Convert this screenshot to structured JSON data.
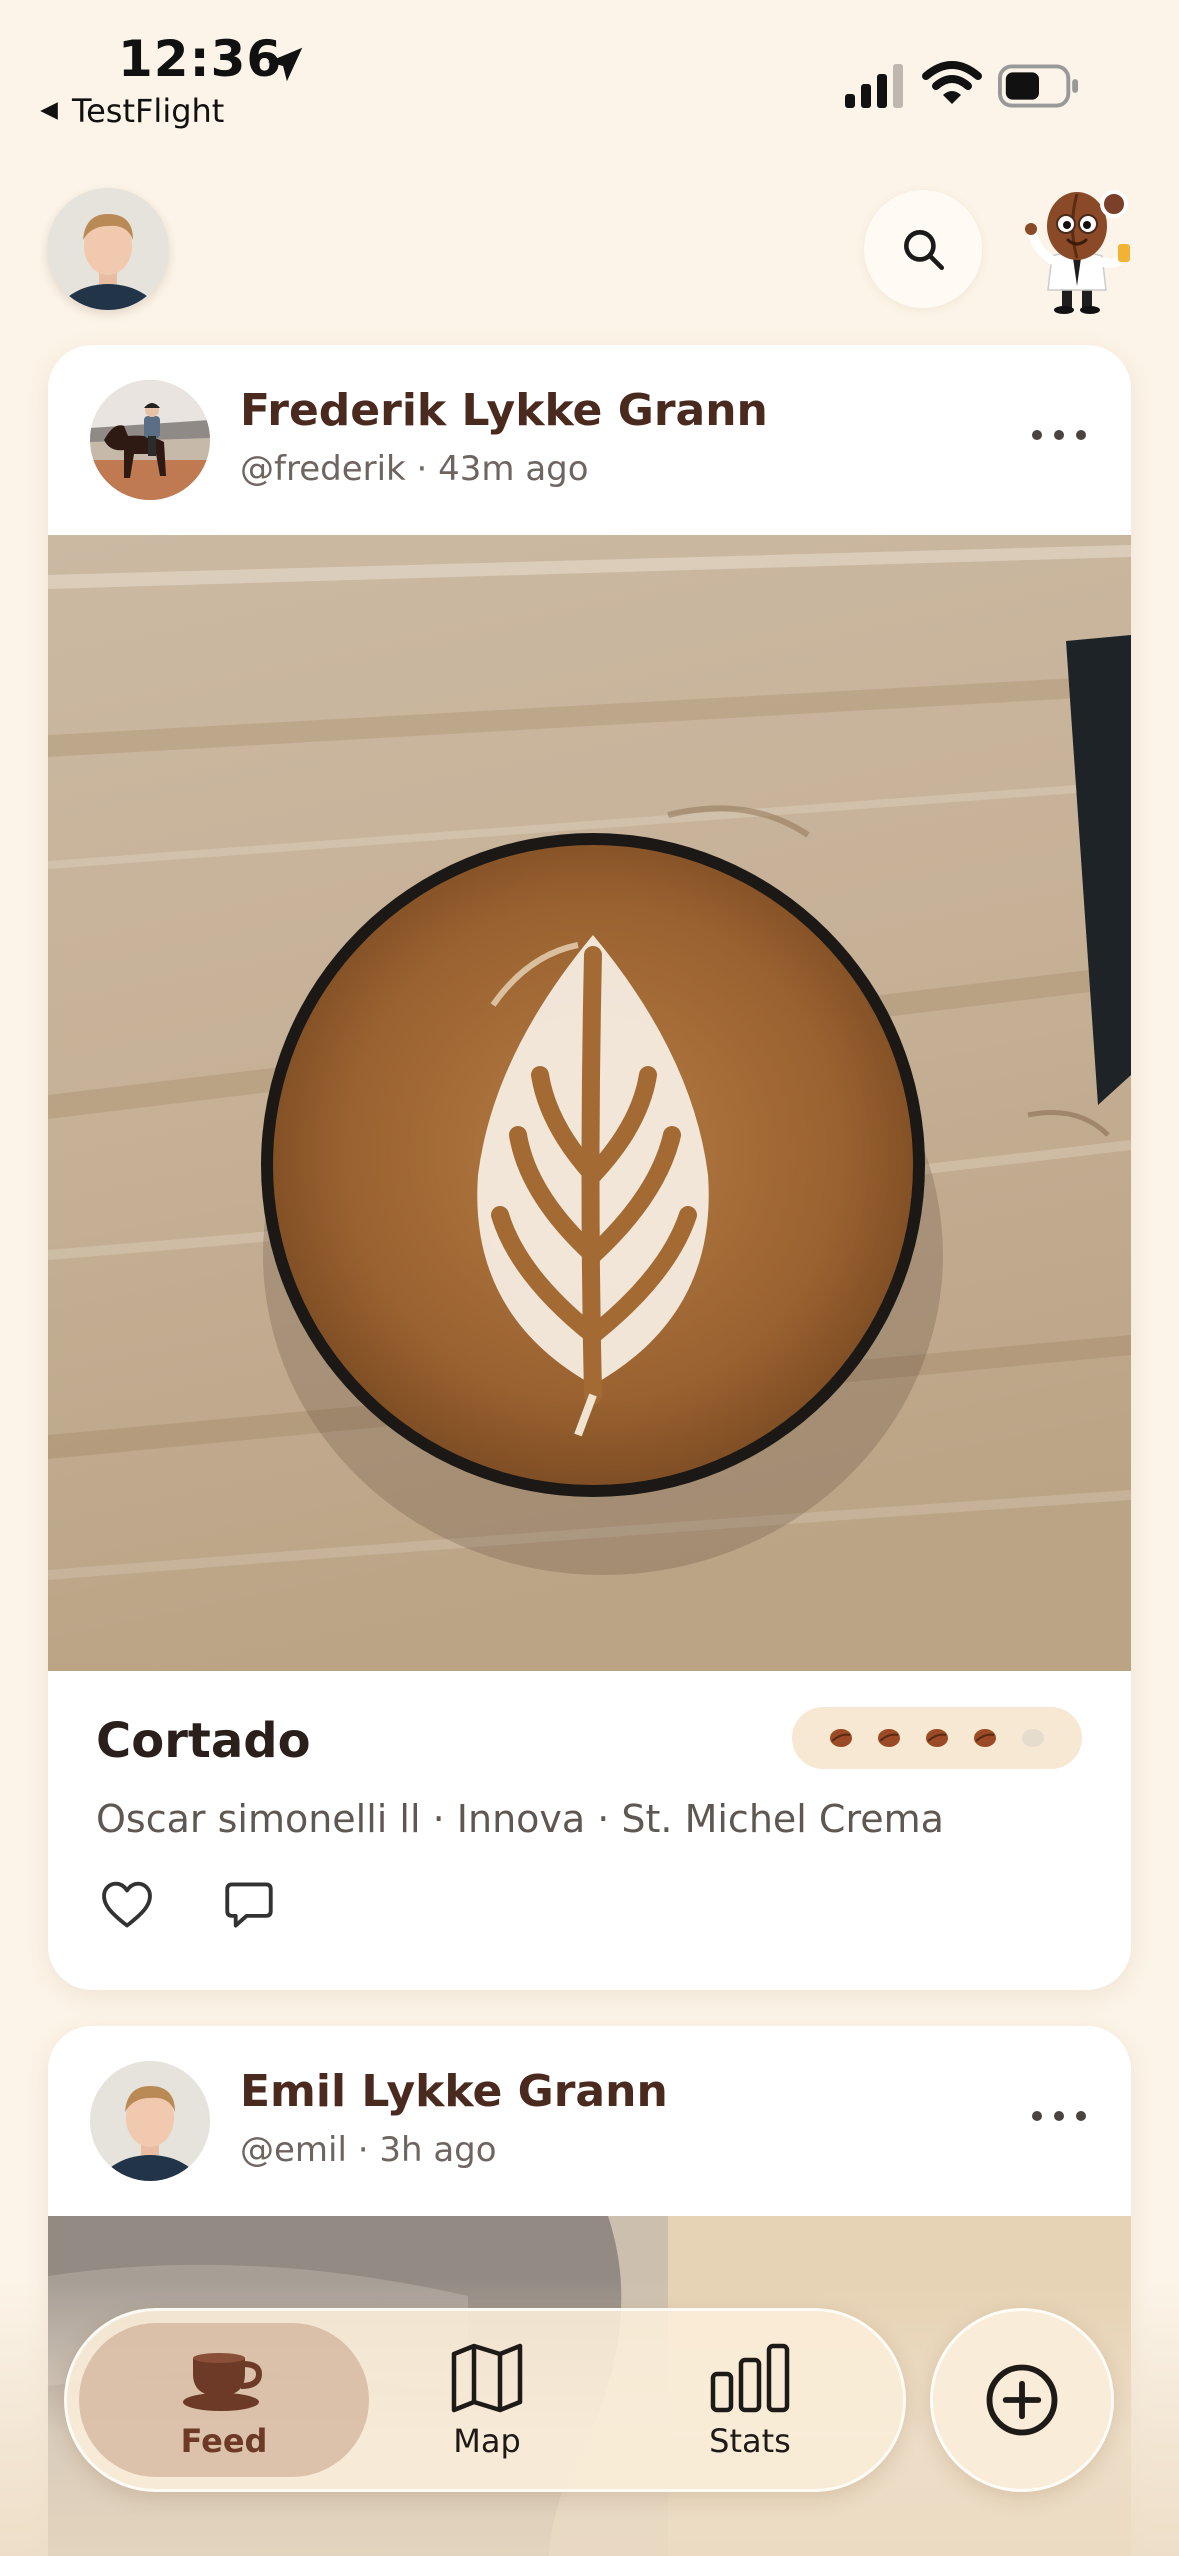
{
  "status_bar": {
    "time": "12:36",
    "back_app": "TestFlight"
  },
  "header": {
    "search_icon": "search-icon",
    "mascot_icon": "coffee-bean-mascot-icon"
  },
  "posts": [
    {
      "author": "Frederik Lykke Grann",
      "meta": "@frederik · 43m ago",
      "drink": "Cortado",
      "details": "Oscar simonelli ll · Innova · St. Michel Crema",
      "rating": 4,
      "rating_max": 5
    },
    {
      "author": "Emil Lykke Grann",
      "meta": "@emil · 3h ago"
    }
  ],
  "tabs": [
    {
      "label": "Feed",
      "icon": "coffee-cup-icon",
      "active": true
    },
    {
      "label": "Map",
      "icon": "map-icon",
      "active": false
    },
    {
      "label": "Stats",
      "icon": "bar-chart-icon",
      "active": false
    }
  ],
  "colors": {
    "background": "#fcf4e8",
    "accent": "#6e3a28",
    "bean": "#9a4a24",
    "pill": "#f6e8d2"
  }
}
